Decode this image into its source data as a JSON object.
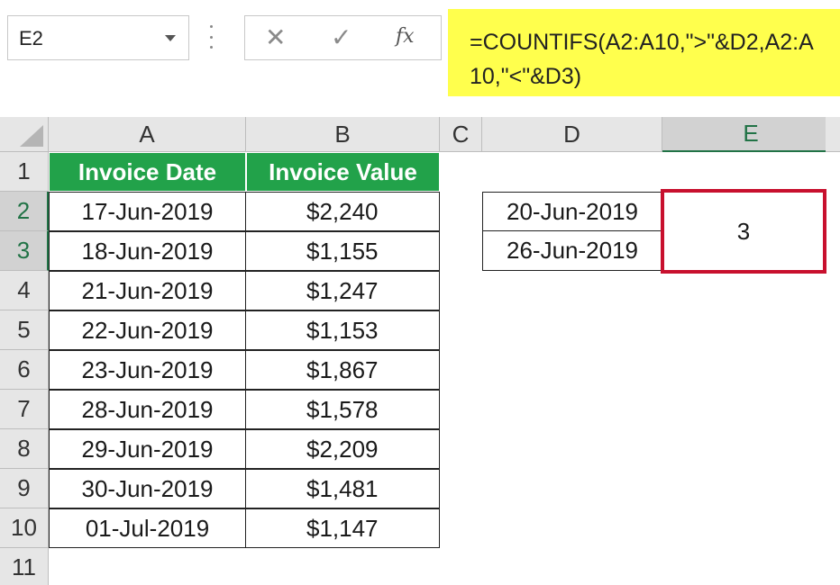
{
  "name_box": {
    "value": "E2"
  },
  "formula_bar": {
    "cancel_glyph": "✕",
    "enter_glyph": "✓",
    "fx_label": "fx",
    "formula": "=COUNTIFS(A2:A10,\">\"&D2,A2:A10,\"<\"&D3)"
  },
  "columns": [
    "A",
    "B",
    "C",
    "D",
    "E"
  ],
  "rows": [
    "1",
    "2",
    "3",
    "4",
    "5",
    "6",
    "7",
    "8",
    "9",
    "10",
    "11"
  ],
  "table": {
    "headers": [
      "Invoice Date",
      "Invoice Value"
    ],
    "dates": [
      "17-Jun-2019",
      "18-Jun-2019",
      "21-Jun-2019",
      "22-Jun-2019",
      "23-Jun-2019",
      "28-Jun-2019",
      "29-Jun-2019",
      "30-Jun-2019",
      "01-Jul-2019"
    ],
    "values": [
      "$2,240",
      "$1,155",
      "$1,247",
      "$1,153",
      "$1,867",
      "$1,578",
      "$2,209",
      "$1,481",
      "$1,147"
    ]
  },
  "criteria": {
    "d2": "20-Jun-2019",
    "d3": "26-Jun-2019"
  },
  "result": {
    "e2": "3"
  },
  "colors": {
    "header_green": "#22a24a",
    "formula_highlight": "#ffff4d",
    "result_border": "#c8102e",
    "selection_green": "#217346"
  }
}
